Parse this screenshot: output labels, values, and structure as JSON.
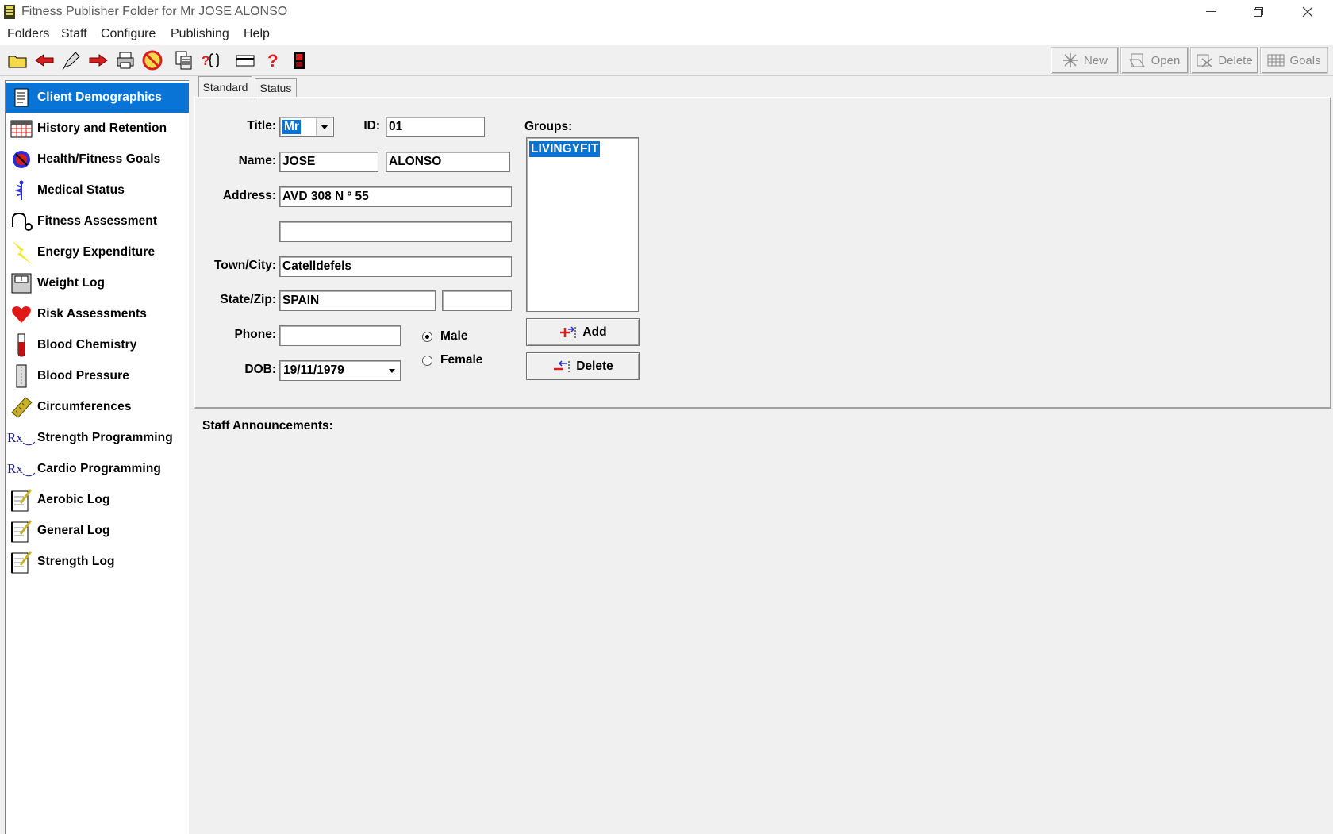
{
  "window": {
    "title": "Fitness Publisher Folder for Mr JOSE ALONSO",
    "controls": {
      "minimize": "—",
      "restore": "❐",
      "close": "✕"
    }
  },
  "menu": [
    "Folders",
    "Staff",
    "Configure",
    "Publishing",
    "Help"
  ],
  "toolbar": {
    "icons": [
      "open-folder-icon",
      "back-arrow-icon",
      "edit-icon",
      "forward-arrow-icon",
      "print-icon",
      "cancel-icon",
      "copy-icon",
      "help-query-icon",
      "card-icon",
      "help-icon",
      "exit-door-icon"
    ],
    "right_buttons": [
      {
        "label": "New",
        "icon": "new-icon"
      },
      {
        "label": "Open",
        "icon": "open-icon"
      },
      {
        "label": "Delete",
        "icon": "delete-icon"
      },
      {
        "label": "Goals",
        "icon": "goals-icon"
      }
    ]
  },
  "sidebar": {
    "items": [
      {
        "label": "Client Demographics",
        "icon": "document-icon",
        "selected": true
      },
      {
        "label": "History and Retention",
        "icon": "calendar-icon"
      },
      {
        "label": "Health/Fitness Goals",
        "icon": "target-icon"
      },
      {
        "label": "Medical Status",
        "icon": "caduceus-icon"
      },
      {
        "label": "Fitness Assessment",
        "icon": "stethoscope-icon"
      },
      {
        "label": "Energy Expenditure",
        "icon": "lightning-icon"
      },
      {
        "label": "Weight Log",
        "icon": "scale-icon"
      },
      {
        "label": "Risk Assessments",
        "icon": "heart-icon"
      },
      {
        "label": "Blood Chemistry",
        "icon": "test-tube-icon"
      },
      {
        "label": "Blood Pressure",
        "icon": "gauge-icon"
      },
      {
        "label": "Circumferences",
        "icon": "tape-measure-icon"
      },
      {
        "label": "Strength Programming",
        "icon": "rx-icon"
      },
      {
        "label": "Cardio Programming",
        "icon": "rx-icon"
      },
      {
        "label": "Aerobic Log",
        "icon": "notepad-icon"
      },
      {
        "label": "General Log",
        "icon": "notepad-icon"
      },
      {
        "label": "Strength Log",
        "icon": "notepad-icon"
      }
    ]
  },
  "tabs": [
    "Standard",
    "Status"
  ],
  "form": {
    "labels": {
      "title": "Title:",
      "id": "ID:",
      "name": "Name:",
      "address": "Address:",
      "town": "Town/City:",
      "statezip": "State/Zip:",
      "phone": "Phone:",
      "dob": "DOB:",
      "groups": "Groups:"
    },
    "title_value": "Mr",
    "id_value": "01",
    "first_name": "JOSE",
    "last_name": "ALONSO",
    "address1": "AVD 308 N º 55",
    "address2": "",
    "town": "Catelldefels",
    "state": "SPAIN",
    "zip": "",
    "phone": "",
    "dob": "19/11/1979",
    "gender_options": [
      "Male",
      "Female"
    ],
    "gender_selected": "Male",
    "groups": [
      "LIVINGYFIT"
    ],
    "add_label": "Add",
    "delete_label": "Delete"
  },
  "announcements": {
    "label": "Staff Announcements:"
  },
  "colors": {
    "selection": "#0a74d6",
    "panel": "#f0f0f0"
  }
}
